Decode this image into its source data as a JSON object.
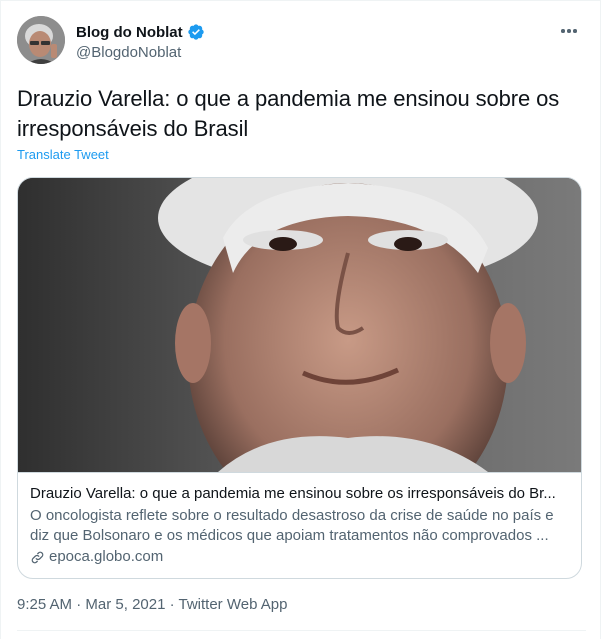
{
  "author": {
    "name": "Blog do Noblat",
    "handle": "@BlogdoNoblat",
    "verified": true
  },
  "tweet": {
    "text": "Drauzio Varella: o que a pandemia me ensinou sobre os irresponsáveis do Brasil",
    "translate_label": "Translate Tweet"
  },
  "card": {
    "title": "Drauzio Varella: o que a pandemia me ensinou sobre os irresponsáveis do Br...",
    "description": "O oncologista reflete sobre o resultado desastroso da crise de saúde no país e diz que Bolsonaro e os médicos que apoiam tratamentos não comprovados ...",
    "domain": "epoca.globo.com"
  },
  "meta": {
    "time": "9:25 AM",
    "separator": " · ",
    "date": "Mar 5, 2021",
    "source": "Twitter Web App"
  },
  "colors": {
    "accent": "#1d9bf0",
    "text_primary": "#0f1419",
    "text_secondary": "#536471",
    "border": "#cfd9de"
  },
  "icons": {
    "verified": "verified-badge-icon",
    "more": "more-icon",
    "link": "link-icon"
  }
}
